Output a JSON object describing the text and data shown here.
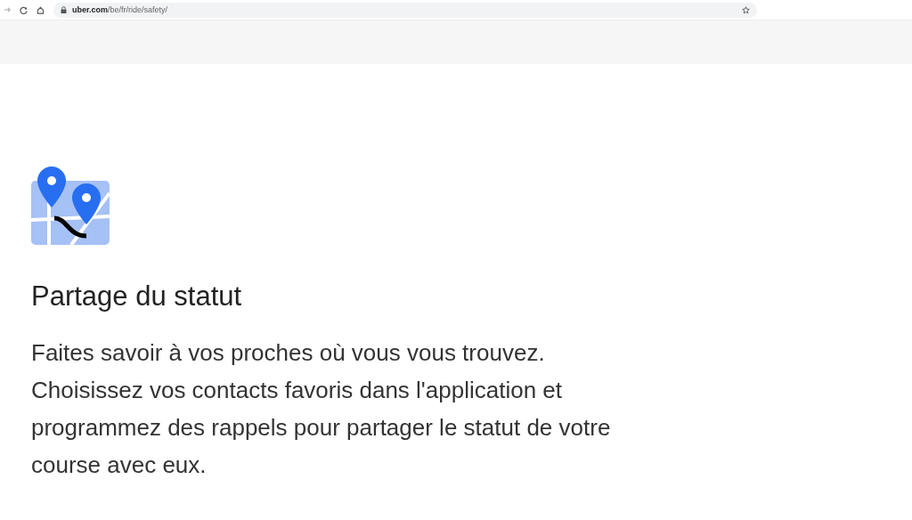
{
  "browser": {
    "url_host": "uber.com",
    "url_path": "/be/fr/ride/safety/"
  },
  "feature": {
    "title": "Partage du statut",
    "description": "Faites savoir à vos proches où vous vous trouvez. Choisissez vos contacts favoris dans l'application et programmez des rappels pour partager le statut de votre course avec eux."
  }
}
